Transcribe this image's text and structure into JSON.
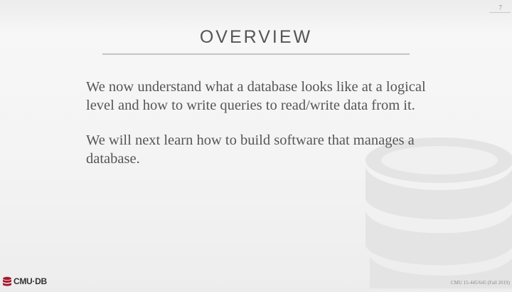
{
  "page_number": "7",
  "title": "OVERVIEW",
  "paragraphs": [
    "We now understand what a database looks like at a logical level and how to write queries to read/write data from it.",
    "We will next learn how to build software that manages a database."
  ],
  "logo_text": "CMU·DB",
  "footer": "CMU 15-445/645 (Fall 2019)",
  "colors": {
    "text": "#555555",
    "logo_red": "#a6192e",
    "watermark": "#e4e4e4"
  },
  "icons": {
    "watermark": "database-cylinder-icon",
    "logo": "cmu-db-logo-icon"
  }
}
